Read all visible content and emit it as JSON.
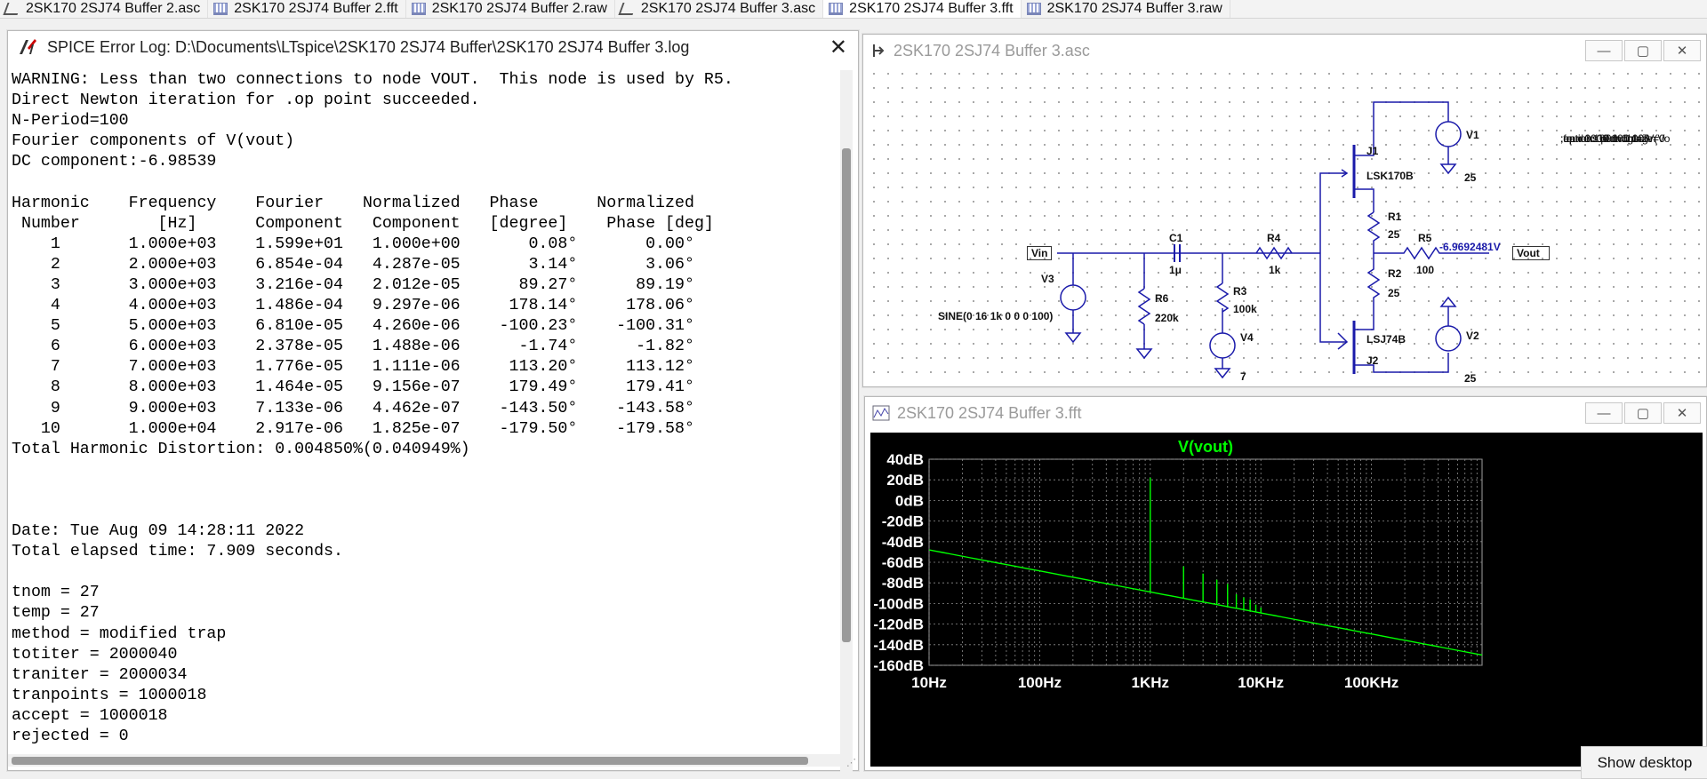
{
  "tabs": [
    {
      "label": "2SK170 2SJ74 Buffer 2.asc",
      "icon": "schematic-icon"
    },
    {
      "label": "2SK170 2SJ74 Buffer 2.fft",
      "icon": "waveform-icon"
    },
    {
      "label": "2SK170 2SJ74 Buffer 2.raw",
      "icon": "waveform-icon"
    },
    {
      "label": "2SK170 2SJ74 Buffer 3.asc",
      "icon": "schematic-icon"
    },
    {
      "label": "2SK170 2SJ74 Buffer 3.fft",
      "icon": "waveform-icon",
      "active": true
    },
    {
      "label": "2SK170 2SJ74 Buffer 3.raw",
      "icon": "waveform-icon"
    }
  ],
  "log_window": {
    "title": "SPICE Error Log: D:\\Documents\\LTspice\\2SK170 2SJ74 Buffer\\2SK170 2SJ74 Buffer 3.log",
    "close_glyph": "✕",
    "lines": [
      "WARNING: Less than two connections to node VOUT.  This node is used by R5.",
      "Direct Newton iteration for .op point succeeded.",
      "N-Period=100",
      "Fourier components of V(vout)",
      "DC component:-6.98539",
      "",
      "Harmonic    Frequency    Fourier    Normalized   Phase      Normalized",
      " Number        [Hz]      Component   Component   [degree]    Phase [deg]",
      "    1       1.000e+03    1.599e+01   1.000e+00       0.08°       0.00°",
      "    2       2.000e+03    6.854e-04   4.287e-05       3.14°       3.06°",
      "    3       3.000e+03    3.216e-04   2.012e-05      89.27°      89.19°",
      "    4       4.000e+03    1.486e-04   9.297e-06     178.14°     178.06°",
      "    5       5.000e+03    6.810e-05   4.260e-06    -100.23°    -100.31°",
      "    6       6.000e+03    2.378e-05   1.488e-06      -1.74°      -1.82°",
      "    7       7.000e+03    1.776e-05   1.111e-06     113.20°     113.12°",
      "    8       8.000e+03    1.464e-05   9.156e-07     179.49°     179.41°",
      "    9       9.000e+03    7.133e-06   4.462e-07    -143.50°    -143.58°",
      "   10       1.000e+04    2.917e-06   1.825e-07    -179.50°    -179.58°",
      "Total Harmonic Distortion: 0.004850%(0.040949%)",
      "",
      "",
      "",
      "Date: Tue Aug 09 14:28:11 2022",
      "Total elapsed time: 7.909 seconds.",
      "",
      "tnom = 27",
      "temp = 27",
      "method = modified trap",
      "totiter = 2000040",
      "traniter = 2000034",
      "tranpoints = 1000018",
      "accept = 1000018",
      "rejected = 0"
    ]
  },
  "schematic_window": {
    "title": "2SK170 2SJ74 Buffer 3.asc",
    "labels": {
      "j1": "J1",
      "lsk170b": "LSK170B",
      "v1": "V1",
      "v1val": "25",
      "r1": "R1",
      "r1val": "25",
      "r5": "R5",
      "r5val": "100",
      "vout_v": "-6.9692481V",
      "vout": "Vout",
      "r2": "R2",
      "r2val": "25",
      "vin": "Vin",
      "c1": "C1",
      "c1val": "1μ",
      "r4": "R4",
      "r4val": "1k",
      "v3": "V3",
      "r6": "R6",
      "r6val": "220k",
      "r3": "R3",
      "r3val": "100k",
      "sine": "SINE(0 16 1k 0 0 0 100)",
      "v4": "V4",
      "v4val": "7",
      "lsj74b": "LSJ74B",
      "j2": "J2",
      "v2": "V2",
      "v2val": "25"
    },
    "directives": [
      ".op",
      ";ac dec 10 1 1meg",
      ";tran 0 100m 0 100n",
      ".four 1000 10 100 V(Vo",
      ".options numdgt=7",
      ".options plotwinsize=0"
    ]
  },
  "fft_window": {
    "title": "2SK170 2SJ74 Buffer 3.fft",
    "chart_data": {
      "type": "line",
      "title": "V(vout)",
      "x_scale": "log",
      "x_ticks": [
        "10Hz",
        "100Hz",
        "1KHz",
        "10KHz",
        "100KHz"
      ],
      "y_ticks": [
        "40dB",
        "20dB",
        "0dB",
        "-20dB",
        "-40dB",
        "-60dB",
        "-80dB",
        "-100dB",
        "-120dB",
        "-140dB",
        "-160dB"
      ],
      "xlim": [
        10,
        1000000
      ],
      "ylim": [
        -160,
        40
      ],
      "grid": true,
      "noise_floor": [
        [
          10,
          -48
        ],
        [
          1000000,
          -150
        ]
      ],
      "harmonics": [
        [
          1000,
          22
        ],
        [
          2000,
          -64
        ],
        [
          3000,
          -71
        ],
        [
          4000,
          -77
        ],
        [
          5000,
          -81
        ],
        [
          6000,
          -91
        ],
        [
          7000,
          -94
        ],
        [
          8000,
          -96
        ],
        [
          9000,
          -101
        ],
        [
          10000,
          -104
        ]
      ],
      "trace_color": "#00ff00"
    },
    "colors": {
      "title": "#00ff00",
      "axis_text": "#ffffff",
      "grid": "#8c8c8c"
    }
  },
  "window_buttons": {
    "minimize": "—",
    "maximize": "▢",
    "close": "✕"
  },
  "show_desktop": "Show desktop"
}
